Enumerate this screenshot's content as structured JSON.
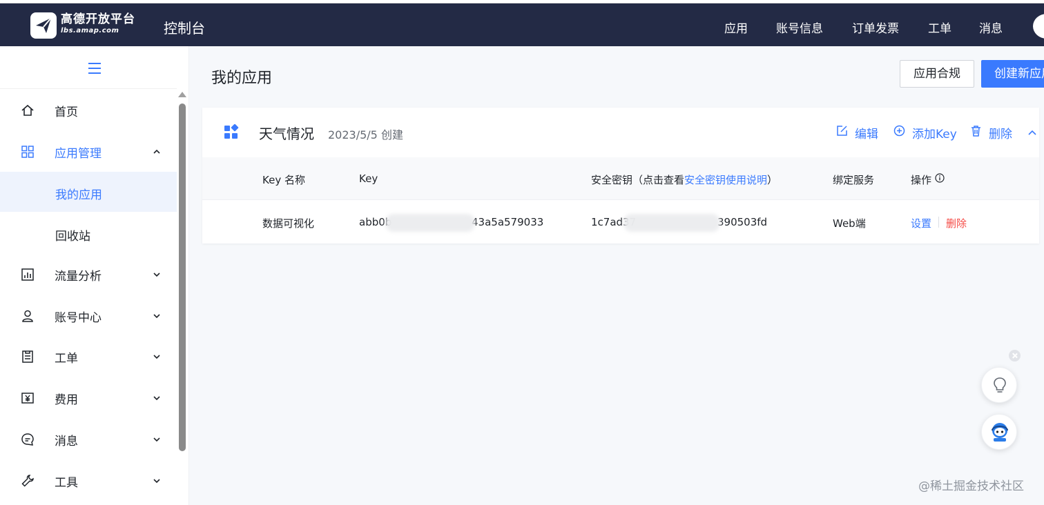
{
  "topbar": {
    "brand_name": "高德开放平台",
    "brand_url": "lbs.amap.com",
    "console_title": "控制台",
    "nav": [
      "应用",
      "账号信息",
      "订单发票",
      "工单",
      "消息"
    ],
    "background": "#232a45"
  },
  "sidebar": {
    "items": [
      {
        "label": "首页",
        "icon": "home-icon"
      },
      {
        "label": "应用管理",
        "icon": "apps-grid-icon",
        "expanded": true
      },
      {
        "label": "流量分析",
        "icon": "chart-icon"
      },
      {
        "label": "账号中心",
        "icon": "user-icon"
      },
      {
        "label": "工单",
        "icon": "ticket-icon"
      },
      {
        "label": "费用",
        "icon": "yuan-icon"
      },
      {
        "label": "消息",
        "icon": "message-icon"
      },
      {
        "label": "工具",
        "icon": "wrench-icon"
      }
    ],
    "subitems": [
      {
        "label": "我的应用",
        "selected": true
      },
      {
        "label": "回收站"
      }
    ]
  },
  "page": {
    "title": "我的应用",
    "compliance_button": "应用合规",
    "create_button": "创建新应用"
  },
  "app": {
    "name": "天气情况",
    "created": "2023/5/5 创建",
    "actions": {
      "edit": "编辑",
      "add_key": "添加Key",
      "delete": "删除"
    },
    "table": {
      "headers": {
        "key_name": "Key 名称",
        "key": "Key",
        "secret_prefix": "安全密钥（点击查看",
        "secret_link": "安全密钥使用说明",
        "secret_suffix": "）",
        "service": "绑定服务",
        "operation": "操作"
      },
      "rows": [
        {
          "key_name": "数据可视化",
          "key": "abb0b",
          "key_tail": "43a5a579033",
          "secret": "1c7ad37",
          "secret_tail": "390503fd",
          "service": "Web端",
          "settings": "设置",
          "delete": "删除"
        }
      ]
    }
  },
  "watermark": "@稀土掘金技术社区",
  "colors": {
    "accent": "#3a7afe",
    "danger": "#f54a45"
  }
}
